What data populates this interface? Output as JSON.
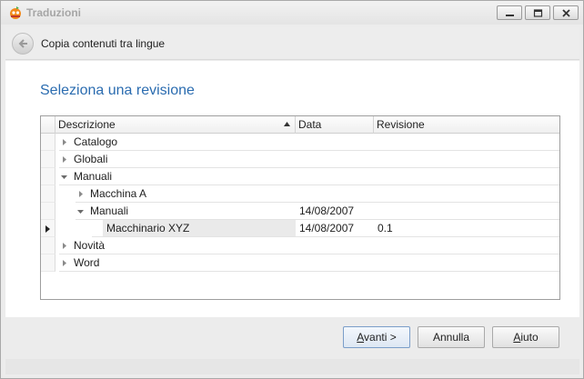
{
  "window": {
    "title": "Traduzioni",
    "icon": "app-logo-icon"
  },
  "header": {
    "title": "Copia contenuti tra lingue",
    "back_icon": "back-arrow-icon"
  },
  "main": {
    "heading": "Seleziona una revisione",
    "grid": {
      "columns": [
        "Descrizione",
        "Data",
        "Revisione"
      ],
      "sorted_column": "Descrizione",
      "sort_direction": "ascending",
      "rows": [
        {
          "label": "Catalogo",
          "level": 0,
          "expander": "collapsed",
          "data": "",
          "revisione": ""
        },
        {
          "label": "Globali",
          "level": 0,
          "expander": "collapsed",
          "data": "",
          "revisione": ""
        },
        {
          "label": "Manuali",
          "level": 0,
          "expander": "expanded",
          "data": "",
          "revisione": ""
        },
        {
          "label": "Macchina A",
          "level": 1,
          "expander": "collapsed",
          "data": "",
          "revisione": ""
        },
        {
          "label": "Manuali",
          "level": 1,
          "expander": "expanded",
          "data": "14/08/2007",
          "revisione": ""
        },
        {
          "label": "Macchinario XYZ",
          "level": 2,
          "expander": "none",
          "data": "14/08/2007",
          "revisione": "0.1",
          "selected": true
        },
        {
          "label": "Novità",
          "level": 0,
          "expander": "collapsed",
          "data": "",
          "revisione": ""
        },
        {
          "label": "Word",
          "level": 0,
          "expander": "collapsed",
          "data": "",
          "revisione": ""
        }
      ]
    }
  },
  "footer": {
    "next_label_mnemonic": "A",
    "next_label_rest": "vanti >",
    "cancel_label": "Annulla",
    "help_label_mnemonic": "A",
    "help_label_rest": "iuto"
  }
}
